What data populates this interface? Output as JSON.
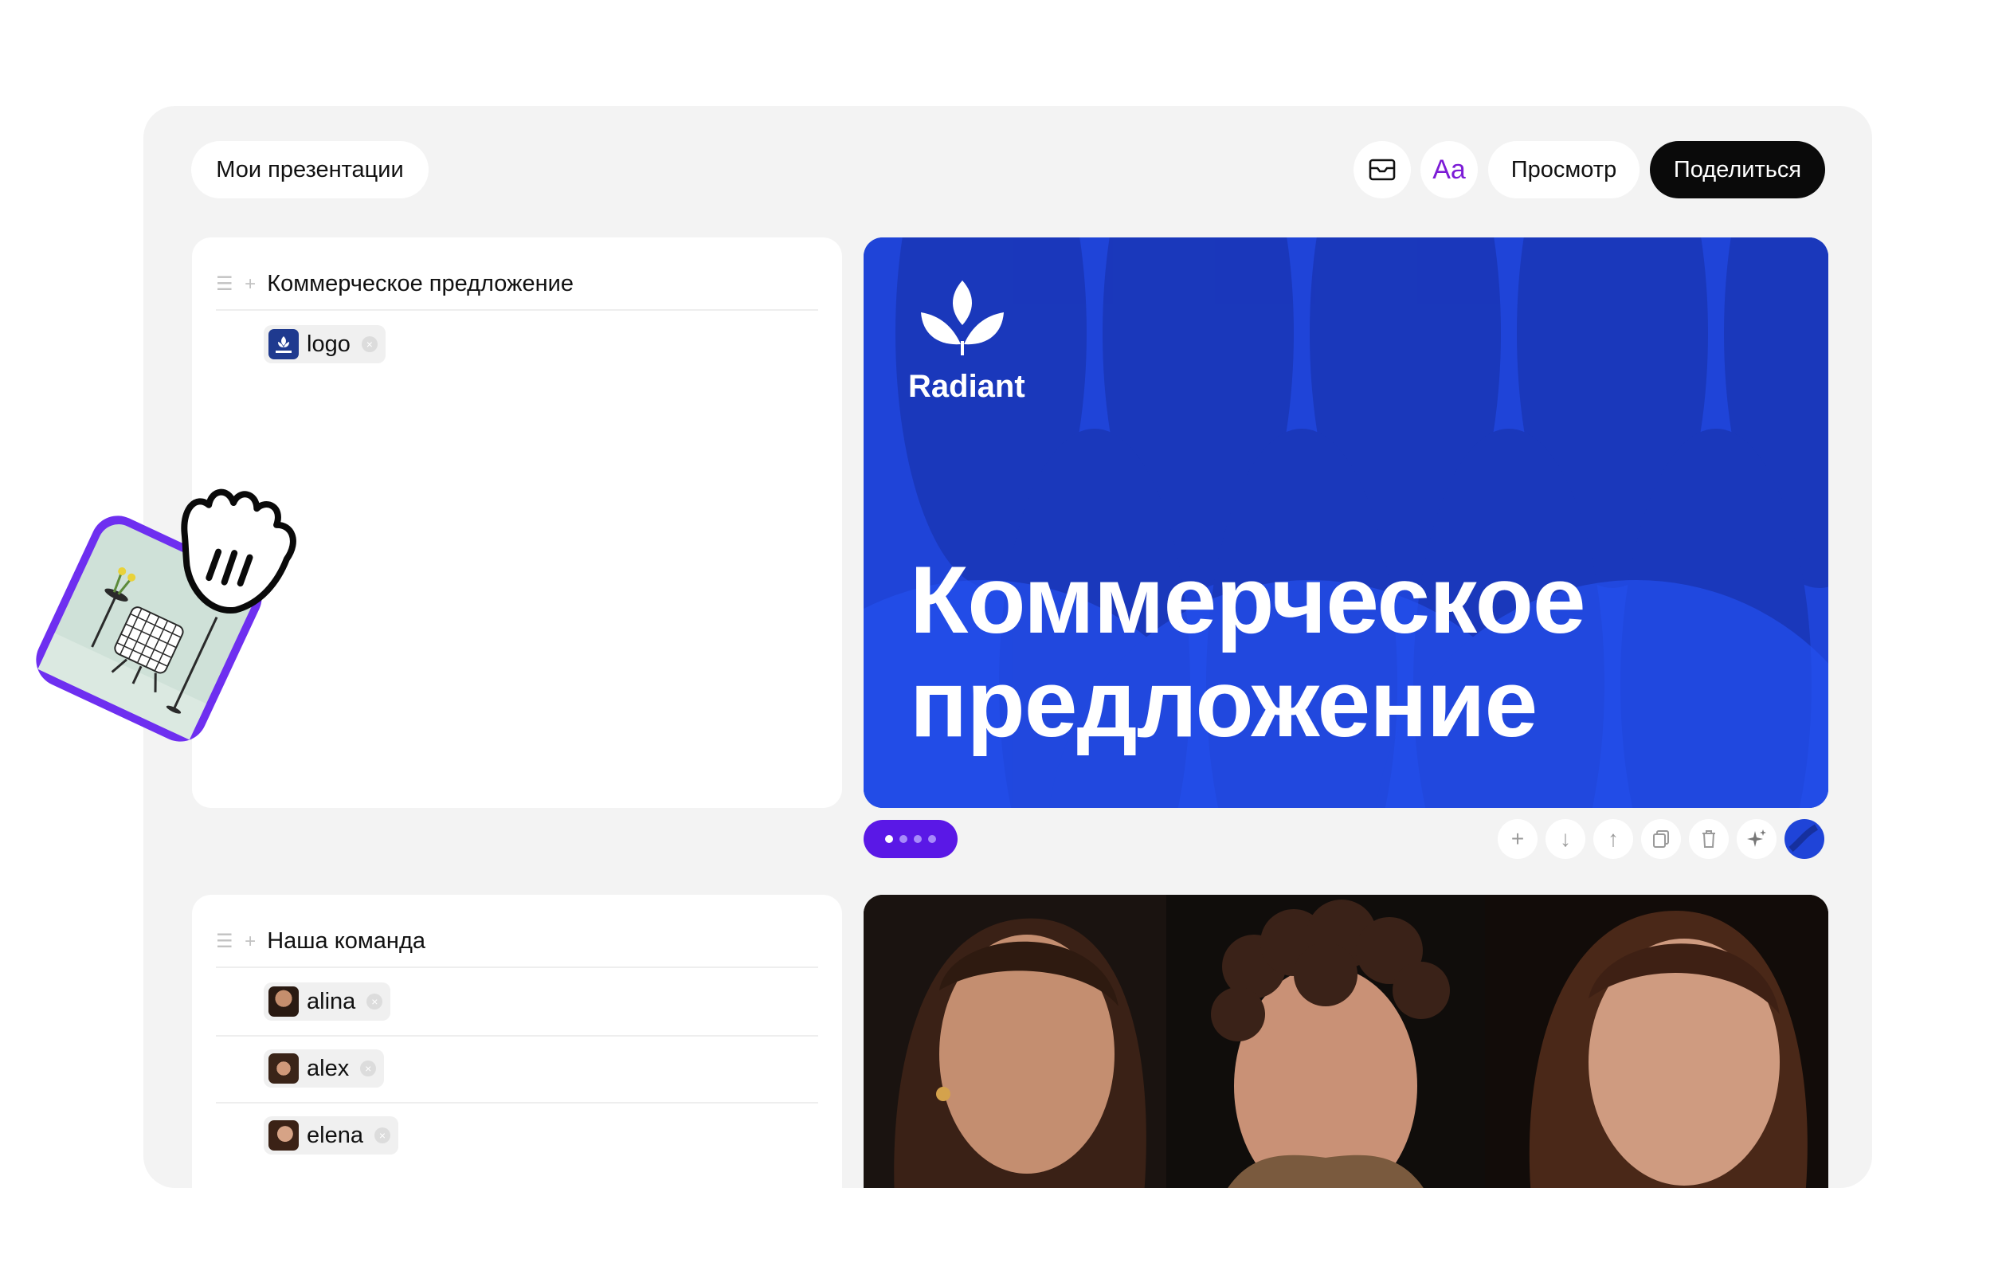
{
  "header": {
    "my_presentations": "Мои презентации",
    "mail_icon": "mail-icon",
    "font_button": "Aa",
    "preview": "Просмотр",
    "share": "Поделиться"
  },
  "sections": [
    {
      "title": "Коммерческое предложение",
      "items": [
        {
          "label": "logo"
        }
      ]
    },
    {
      "title": "Наша команда",
      "items": [
        {
          "label": "alina"
        },
        {
          "label": "alex"
        },
        {
          "label": "elena"
        }
      ]
    }
  ],
  "slide1": {
    "brand": "Radiant",
    "headline_line1": "Коммерческое",
    "headline_line2": "предложение",
    "bg_color": "#1f44d8"
  },
  "slide_tools": [
    "add-icon",
    "move-down-icon",
    "move-up-icon",
    "duplicate-icon",
    "trash-icon",
    "sparkle-icon",
    "color-swatch-icon"
  ],
  "colors": {
    "accent": "#7c1bd6",
    "dots_pill": "#5a18e6",
    "share_bg": "#0a0a0a"
  }
}
